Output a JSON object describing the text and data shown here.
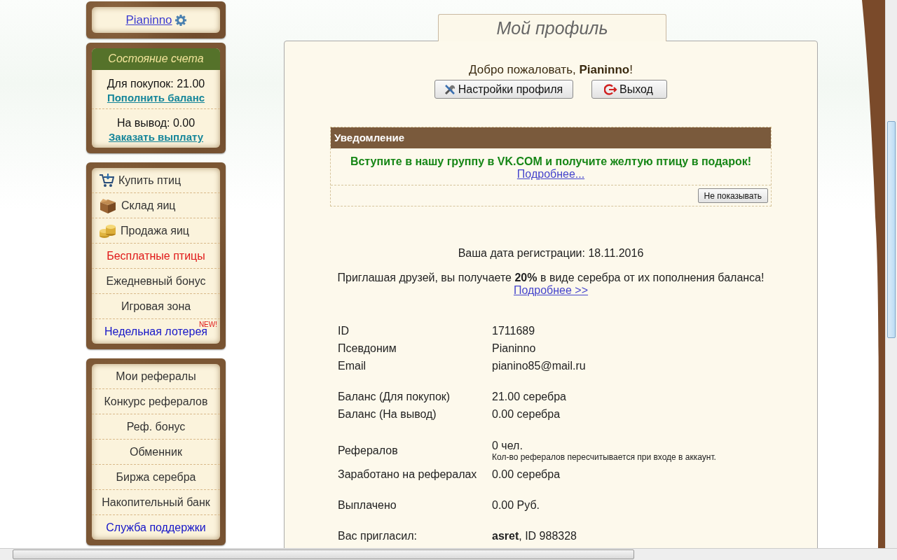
{
  "user_box": {
    "username": "Pianinno"
  },
  "account": {
    "title": "Состояние счета",
    "sections": [
      {
        "text": "Для покупок: 21.00",
        "link": "Пополнить баланс"
      },
      {
        "text": "На вывод: 0.00",
        "link": "Заказать выплату"
      }
    ]
  },
  "menus": [
    {
      "items": [
        {
          "kind": "cart",
          "label": "Купить птиц",
          "color": "#333333"
        },
        {
          "kind": "box",
          "label": "Склад яиц",
          "color": "#333333"
        },
        {
          "kind": "coins",
          "label": "Продажа яиц",
          "color": "#333333"
        },
        {
          "kind": "plain",
          "label": "Бесплатные птицы",
          "color": "#e01818"
        },
        {
          "kind": "plain",
          "label": "Ежедневный бонус",
          "color": "#333333"
        },
        {
          "kind": "plain",
          "label": "Игровая зона",
          "color": "#333333"
        },
        {
          "kind": "plain",
          "label": "Недельная лотерея",
          "color": "#1414c8",
          "badge": "NEW!"
        }
      ]
    },
    {
      "items": [
        {
          "kind": "plain",
          "label": "Мои рефералы",
          "color": "#333333"
        },
        {
          "kind": "plain",
          "label": "Конкурс рефералов",
          "color": "#333333"
        },
        {
          "kind": "plain",
          "label": "Реф. бонус",
          "color": "#333333"
        },
        {
          "kind": "plain",
          "label": "Обменник",
          "color": "#333333"
        },
        {
          "kind": "plain",
          "label": "Биржа серебра",
          "color": "#333333"
        },
        {
          "kind": "plain",
          "label": "Накопительный банк",
          "color": "#333333"
        },
        {
          "kind": "plain",
          "label": "Служба поддержки",
          "color": "#1414c8"
        }
      ]
    }
  ],
  "page_tab": {
    "title": "Мой профиль"
  },
  "welcome": "Добро пожаловать, **Pianinno**!",
  "buttons": [
    {
      "kind": "settings",
      "label": "Настройки профиля"
    },
    {
      "kind": "logout",
      "label": "Выход"
    }
  ],
  "notice": {
    "title": "Уведомление",
    "message": "Вступите в нашу группу в VK.COM и получите желтую птицу в подарок!",
    "link": "Подробнее...",
    "dismiss": "Не показывать"
  },
  "registration": "Ваша дата регистрации: 18.11.2016",
  "invite": {
    "text": "Приглашая друзей, вы получаете **20%** в виде серебра от их пополнения баланса!",
    "link": "Подробнее >>"
  },
  "profile_groups": [
    [
      {
        "label": "ID",
        "value": "1711689"
      },
      {
        "label": "Псевдоним",
        "value": "Pianinno"
      },
      {
        "label": "Email",
        "value": "pianino85@mail.ru"
      }
    ],
    [
      {
        "label": "Баланс (Для покупок)",
        "value": "21.00 серебра"
      },
      {
        "label": "Баланс (На вывод)",
        "value": "0.00 серебра"
      }
    ],
    [
      {
        "label": "Рефералов",
        "value": "0 чел.",
        "note": "Кол-во рефералов пересчитывается при входе в аккаунт."
      },
      {
        "label": "Заработано на рефералах",
        "value": "0.00 серебра"
      }
    ],
    [
      {
        "label": "Выплачено",
        "value": "0.00 Руб."
      }
    ],
    [
      {
        "label": "Вас пригласил:",
        "value": "**asret**, ID 988328"
      }
    ]
  ]
}
